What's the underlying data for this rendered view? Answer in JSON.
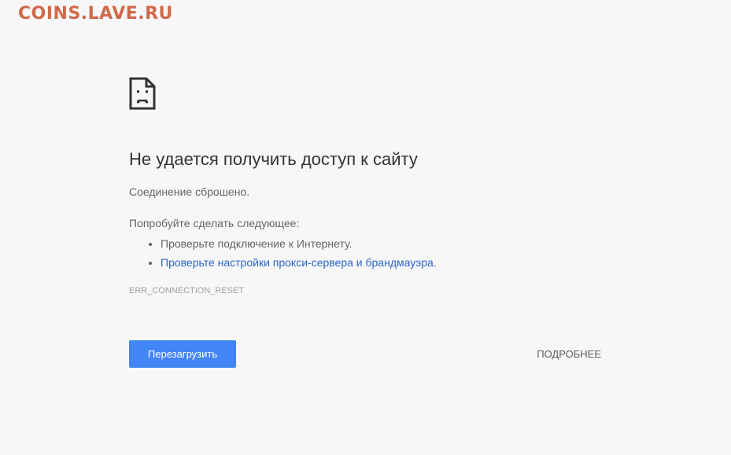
{
  "watermark": "COINS.LAVE.RU",
  "error_page": {
    "icon": "sad-page-icon",
    "heading": "Не удается получить доступ к сайту",
    "subtitle": "Соединение сброшено.",
    "try_label": "Попробуйте сделать следующее:",
    "suggestions": [
      {
        "text": "Проверьте подключение к Интернету.",
        "is_link": false
      },
      {
        "link_text": "Проверьте настройки прокси-сервера и брандмауэра",
        "suffix": ".",
        "is_link": true
      }
    ],
    "error_code": "ERR_CONNECTION_RESET",
    "reload_label": "Перезагрузить",
    "details_label": "ПОДРОБНЕЕ"
  },
  "colors": {
    "background": "#f7f7f7",
    "accent": "#4285f4",
    "link": "#2a65c8",
    "watermark": "#d0694a"
  }
}
